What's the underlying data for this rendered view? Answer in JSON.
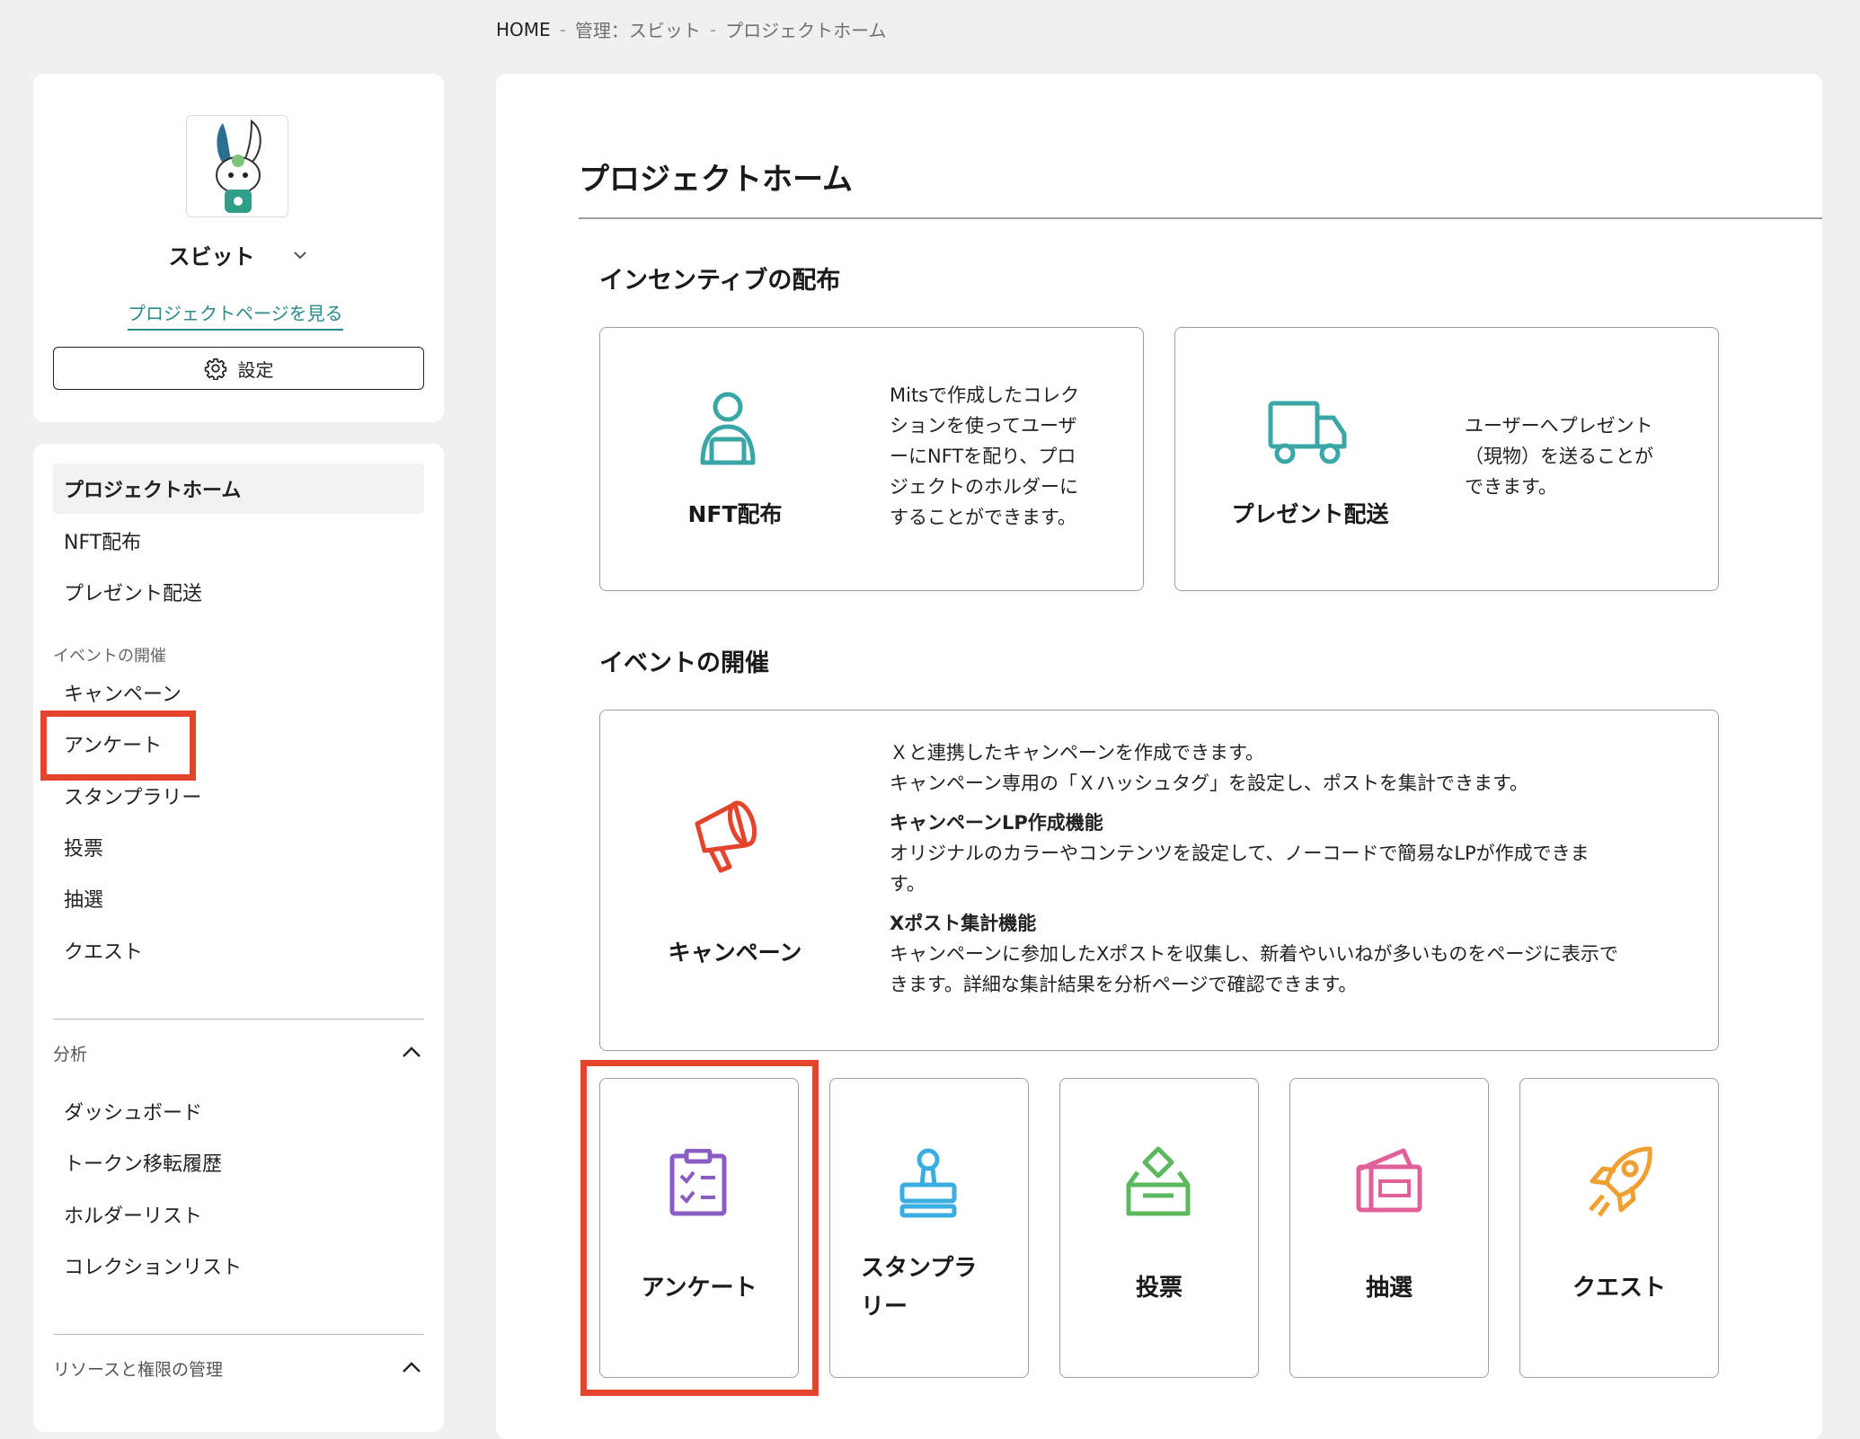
{
  "breadcrumb": {
    "home": "HOME",
    "sep": "-",
    "admin": "管理：スビット",
    "current": "プロジェクトホーム"
  },
  "sidebar": {
    "project_name": "スビット",
    "project_link": "プロジェクトページを見る",
    "settings_label": "設定",
    "items_top": [
      {
        "label": "プロジェクトホーム"
      },
      {
        "label": "NFT配布"
      },
      {
        "label": "プレゼント配送"
      }
    ],
    "event_group_label": "イベントの開催",
    "event_items": [
      {
        "label": "キャンペーン"
      },
      {
        "label": "アンケート"
      },
      {
        "label": "スタンプラリー"
      },
      {
        "label": "投票"
      },
      {
        "label": "抽選"
      },
      {
        "label": "クエスト"
      }
    ],
    "analysis_label": "分析",
    "analysis_items": [
      {
        "label": "ダッシュボード"
      },
      {
        "label": "トークン移転履歴"
      },
      {
        "label": "ホルダーリスト"
      },
      {
        "label": "コレクションリスト"
      }
    ],
    "resources_label": "リソースと権限の管理"
  },
  "main": {
    "title": "プロジェクトホーム",
    "incentive_title": "インセンティブの配布",
    "nft_card": {
      "label": "NFT配布",
      "desc_lines": [
        "Mitsで作成したコレク",
        "ションを使ってユーザ",
        "ーにNFTを配り、プロ",
        "ジェクトのホルダーに",
        "することができます。"
      ]
    },
    "present_card": {
      "label": "プレゼント配送",
      "desc_lines": [
        "ユーザーへプレゼント",
        "（現物）を送ることが",
        "できます。"
      ]
    },
    "event_title": "イベントの開催",
    "campaign_card": {
      "label": "キャンペーン",
      "line1": "Ｘと連携したキャンペーンを作成できます。",
      "line2": "キャンペーン専用の「Ｘハッシュタグ」を設定し、ポストを集計できます。",
      "h1": "キャンペーンLP作成機能",
      "p1a": "オリジナルのカラーやコンテンツを設定して、ノーコードで簡易なLPが作成できま",
      "p1b": "す。",
      "h2": "Xポスト集計機能",
      "p2a": "キャンペーンに参加したXポストを収集し、新着やいいねが多いものをページに表示で",
      "p2b": "きます。詳細な集計結果を分析ページで確認できます。"
    },
    "small_cards": [
      {
        "label": "アンケート",
        "icon": "survey-clipboard-icon",
        "color": "#8a5cc4"
      },
      {
        "label1": "スタンプラ",
        "label2": "リー",
        "icon": "stamp-icon",
        "color": "#3aaee0"
      },
      {
        "label": "投票",
        "icon": "ballot-box-icon",
        "color": "#5cb85c"
      },
      {
        "label": "抽選",
        "icon": "lottery-ticket-icon",
        "color": "#e0609a"
      },
      {
        "label": "クエスト",
        "icon": "rocket-icon",
        "color": "#f0a030"
      }
    ]
  },
  "colors": {
    "highlight_red": "#e4432c",
    "teal": "#3aa6a6",
    "campaign_red": "#e4432c"
  }
}
